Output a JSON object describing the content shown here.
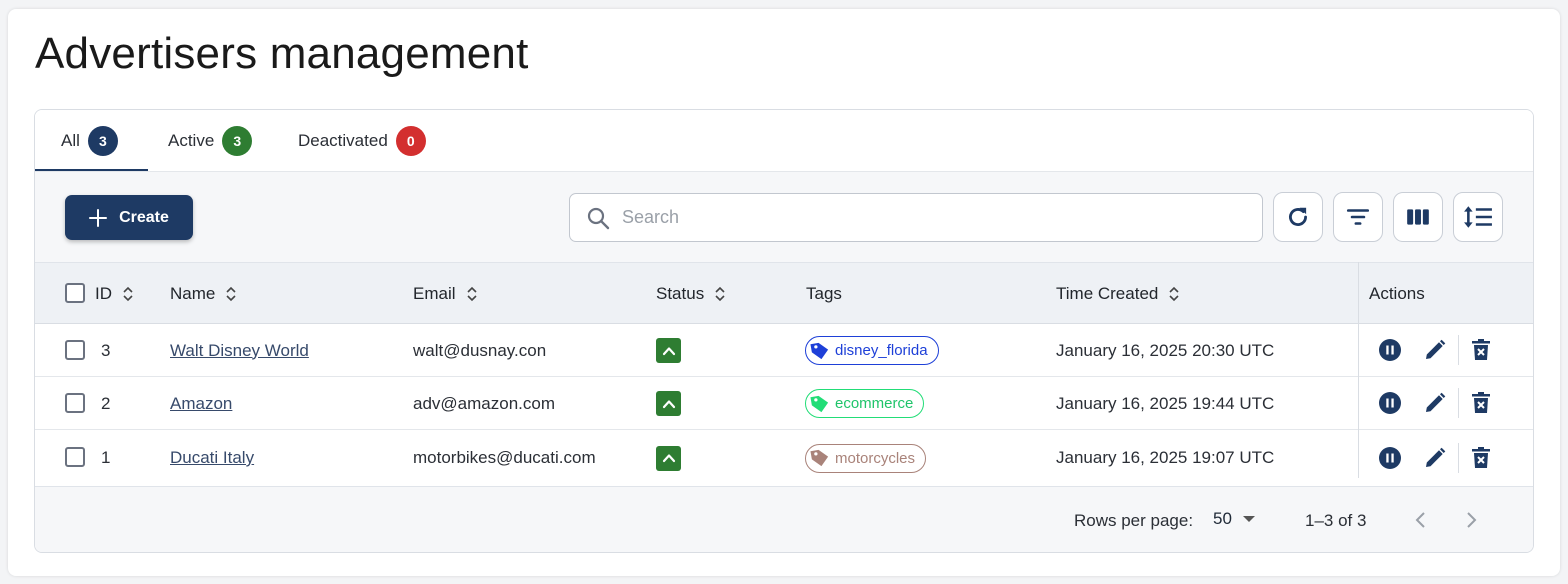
{
  "page": {
    "title": "Advertisers management"
  },
  "tabs": [
    {
      "label": "All",
      "count": "3",
      "color": "#1e3a64"
    },
    {
      "label": "Active",
      "count": "3",
      "color": "#2e7d32"
    },
    {
      "label": "Deactivated",
      "count": "0",
      "color": "#d32f2f"
    }
  ],
  "toolbar": {
    "create_label": "Create",
    "search_placeholder": "Search"
  },
  "table": {
    "headers": {
      "id": "ID",
      "name": "Name",
      "email": "Email",
      "status": "Status",
      "tags": "Tags",
      "time_created": "Time Created",
      "actions": "Actions"
    },
    "rows": [
      {
        "id": "3",
        "name": "Walt Disney World",
        "email": "walt@dusnay.con",
        "tag": "disney_florida",
        "tag_color": "#1e40d8",
        "time": "January 16, 2025 20:30 UTC"
      },
      {
        "id": "2",
        "name": "Amazon",
        "email": "adv@amazon.com",
        "tag": "ecommerce",
        "tag_color": "#22dd77",
        "time": "January 16, 2025 19:44 UTC"
      },
      {
        "id": "1",
        "name": "Ducati Italy",
        "email": "motorbikes@ducati.com",
        "tag": "motorcycles",
        "tag_color": "#a9837a",
        "time": "January 16, 2025 19:07 UTC"
      }
    ]
  },
  "footer": {
    "rows_per_page_label": "Rows per page:",
    "rows_per_page_value": "50",
    "range": "1–3 of 3"
  },
  "colors": {
    "primary": "#1e3a64",
    "status_active": "#2e7d32",
    "deactivated": "#d32f2f"
  }
}
